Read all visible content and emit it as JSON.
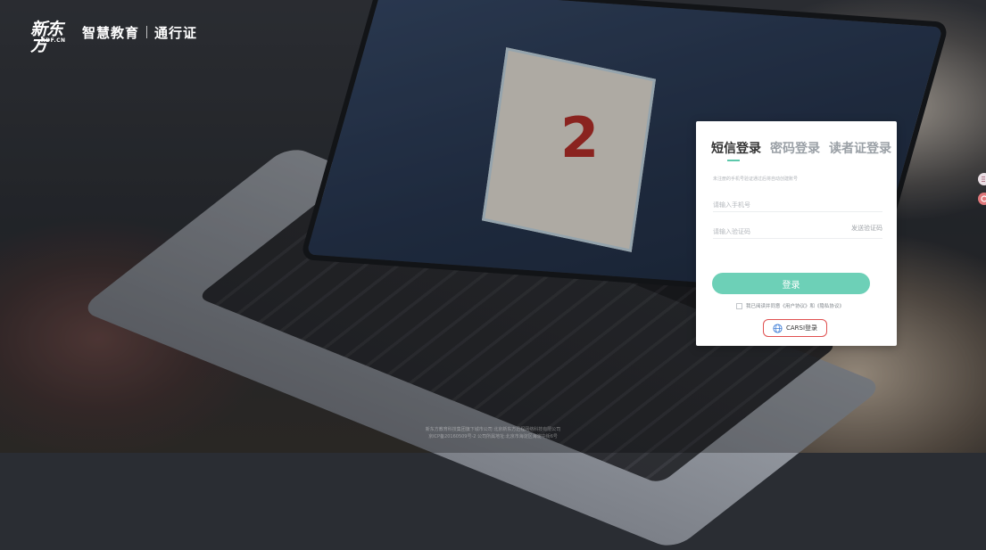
{
  "header": {
    "brand_mark": "新东方",
    "brand_sub": "XDF.CN",
    "brand_name": "智慧教育",
    "pass_label": "通行证"
  },
  "login": {
    "tabs": [
      {
        "label": "短信登录",
        "active": true
      },
      {
        "label": "密码登录",
        "active": false
      },
      {
        "label": "读者证登录",
        "active": false
      }
    ],
    "hint": "未注册的手机号验证通过后将自动创建账号",
    "phone_placeholder": "请输入手机号",
    "code_placeholder": "请输入验证码",
    "send_code_label": "发送验证码",
    "submit_label": "登录",
    "agreement_text": "我已阅读并同意《用户协议》和《隐私协议》",
    "carsi_label": "CARSI登录"
  },
  "laptop_screen": {
    "number": "2"
  },
  "footer": {
    "line1": "新东方教育科技集团旗下城市公司 北京新东方迅程网络科技有限公司",
    "line2": "京ICP备20160509号-2 公司所属地址:北京市海淀区海淀中街6号"
  },
  "colors": {
    "accent": "#6dd0b7",
    "tab_indicator": "#5cc8ab",
    "carsi_border": "#e05050"
  }
}
